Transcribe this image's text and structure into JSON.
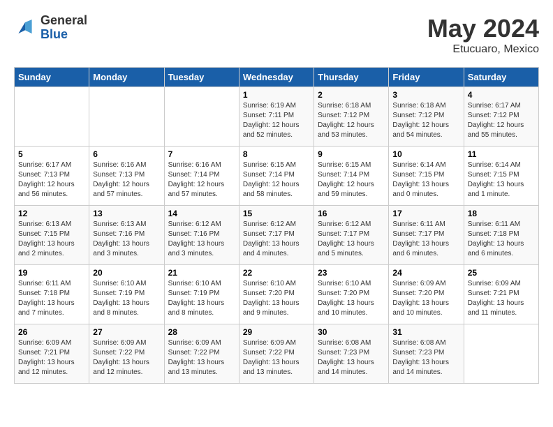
{
  "header": {
    "logo_general": "General",
    "logo_blue": "Blue",
    "title": "May 2024",
    "location": "Etucuaro, Mexico"
  },
  "days_of_week": [
    "Sunday",
    "Monday",
    "Tuesday",
    "Wednesday",
    "Thursday",
    "Friday",
    "Saturday"
  ],
  "weeks": [
    [
      {
        "day": "",
        "info": ""
      },
      {
        "day": "",
        "info": ""
      },
      {
        "day": "",
        "info": ""
      },
      {
        "day": "1",
        "info": "Sunrise: 6:19 AM\nSunset: 7:11 PM\nDaylight: 12 hours and 52 minutes."
      },
      {
        "day": "2",
        "info": "Sunrise: 6:18 AM\nSunset: 7:12 PM\nDaylight: 12 hours and 53 minutes."
      },
      {
        "day": "3",
        "info": "Sunrise: 6:18 AM\nSunset: 7:12 PM\nDaylight: 12 hours and 54 minutes."
      },
      {
        "day": "4",
        "info": "Sunrise: 6:17 AM\nSunset: 7:12 PM\nDaylight: 12 hours and 55 minutes."
      }
    ],
    [
      {
        "day": "5",
        "info": "Sunrise: 6:17 AM\nSunset: 7:13 PM\nDaylight: 12 hours and 56 minutes."
      },
      {
        "day": "6",
        "info": "Sunrise: 6:16 AM\nSunset: 7:13 PM\nDaylight: 12 hours and 57 minutes."
      },
      {
        "day": "7",
        "info": "Sunrise: 6:16 AM\nSunset: 7:14 PM\nDaylight: 12 hours and 57 minutes."
      },
      {
        "day": "8",
        "info": "Sunrise: 6:15 AM\nSunset: 7:14 PM\nDaylight: 12 hours and 58 minutes."
      },
      {
        "day": "9",
        "info": "Sunrise: 6:15 AM\nSunset: 7:14 PM\nDaylight: 12 hours and 59 minutes."
      },
      {
        "day": "10",
        "info": "Sunrise: 6:14 AM\nSunset: 7:15 PM\nDaylight: 13 hours and 0 minutes."
      },
      {
        "day": "11",
        "info": "Sunrise: 6:14 AM\nSunset: 7:15 PM\nDaylight: 13 hours and 1 minute."
      }
    ],
    [
      {
        "day": "12",
        "info": "Sunrise: 6:13 AM\nSunset: 7:15 PM\nDaylight: 13 hours and 2 minutes."
      },
      {
        "day": "13",
        "info": "Sunrise: 6:13 AM\nSunset: 7:16 PM\nDaylight: 13 hours and 3 minutes."
      },
      {
        "day": "14",
        "info": "Sunrise: 6:12 AM\nSunset: 7:16 PM\nDaylight: 13 hours and 3 minutes."
      },
      {
        "day": "15",
        "info": "Sunrise: 6:12 AM\nSunset: 7:17 PM\nDaylight: 13 hours and 4 minutes."
      },
      {
        "day": "16",
        "info": "Sunrise: 6:12 AM\nSunset: 7:17 PM\nDaylight: 13 hours and 5 minutes."
      },
      {
        "day": "17",
        "info": "Sunrise: 6:11 AM\nSunset: 7:17 PM\nDaylight: 13 hours and 6 minutes."
      },
      {
        "day": "18",
        "info": "Sunrise: 6:11 AM\nSunset: 7:18 PM\nDaylight: 13 hours and 6 minutes."
      }
    ],
    [
      {
        "day": "19",
        "info": "Sunrise: 6:11 AM\nSunset: 7:18 PM\nDaylight: 13 hours and 7 minutes."
      },
      {
        "day": "20",
        "info": "Sunrise: 6:10 AM\nSunset: 7:19 PM\nDaylight: 13 hours and 8 minutes."
      },
      {
        "day": "21",
        "info": "Sunrise: 6:10 AM\nSunset: 7:19 PM\nDaylight: 13 hours and 8 minutes."
      },
      {
        "day": "22",
        "info": "Sunrise: 6:10 AM\nSunset: 7:20 PM\nDaylight: 13 hours and 9 minutes."
      },
      {
        "day": "23",
        "info": "Sunrise: 6:10 AM\nSunset: 7:20 PM\nDaylight: 13 hours and 10 minutes."
      },
      {
        "day": "24",
        "info": "Sunrise: 6:09 AM\nSunset: 7:20 PM\nDaylight: 13 hours and 10 minutes."
      },
      {
        "day": "25",
        "info": "Sunrise: 6:09 AM\nSunset: 7:21 PM\nDaylight: 13 hours and 11 minutes."
      }
    ],
    [
      {
        "day": "26",
        "info": "Sunrise: 6:09 AM\nSunset: 7:21 PM\nDaylight: 13 hours and 12 minutes."
      },
      {
        "day": "27",
        "info": "Sunrise: 6:09 AM\nSunset: 7:22 PM\nDaylight: 13 hours and 12 minutes."
      },
      {
        "day": "28",
        "info": "Sunrise: 6:09 AM\nSunset: 7:22 PM\nDaylight: 13 hours and 13 minutes."
      },
      {
        "day": "29",
        "info": "Sunrise: 6:09 AM\nSunset: 7:22 PM\nDaylight: 13 hours and 13 minutes."
      },
      {
        "day": "30",
        "info": "Sunrise: 6:08 AM\nSunset: 7:23 PM\nDaylight: 13 hours and 14 minutes."
      },
      {
        "day": "31",
        "info": "Sunrise: 6:08 AM\nSunset: 7:23 PM\nDaylight: 13 hours and 14 minutes."
      },
      {
        "day": "",
        "info": ""
      }
    ]
  ]
}
